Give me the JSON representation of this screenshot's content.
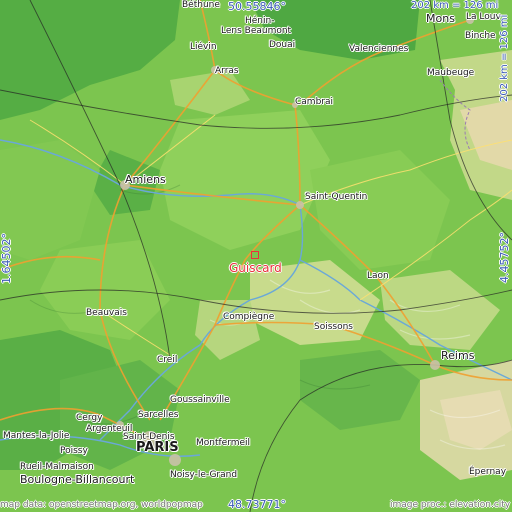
{
  "map": {
    "highlight_place": "Guiscard",
    "colors": {
      "lowland": "#5fb849",
      "midland": "#8ccf55",
      "upland": "#c7db8a",
      "hills": "#ded3a4",
      "water": "#6aa8d8",
      "roads": "#f0a030",
      "borders": "#222222",
      "accent": "#e8323c",
      "coord": "#3d5cb8"
    },
    "coords": {
      "top": "50.55846°",
      "bottom": "48.73771°",
      "left": "1.64502°",
      "right": "4.45752°"
    },
    "scale": {
      "top": "202 km = 126 mi",
      "right": "202 km = 126 mi"
    },
    "credits": {
      "left": "map data: openstreetmap.org, worldpopmap",
      "right": "image proc.: elevation.city"
    },
    "cities": [
      {
        "name": "Béthune"
      },
      {
        "name": "Hénin-"
      },
      {
        "name": "Lens Beaumont"
      },
      {
        "name": "Liévin"
      },
      {
        "name": "Douai"
      },
      {
        "name": "Arras"
      },
      {
        "name": "Mons"
      },
      {
        "name": "La Louv"
      },
      {
        "name": "Binche"
      },
      {
        "name": "Valenciennes"
      },
      {
        "name": "Maubeuge"
      },
      {
        "name": "Cambrai"
      },
      {
        "name": "Amiens"
      },
      {
        "name": "Saint-Quentin"
      },
      {
        "name": "Laon"
      },
      {
        "name": "Beauvais"
      },
      {
        "name": "Compiègne"
      },
      {
        "name": "Soissons"
      },
      {
        "name": "Reims"
      },
      {
        "name": "Creil"
      },
      {
        "name": "Goussainville"
      },
      {
        "name": "Cergy"
      },
      {
        "name": "Sarcelles"
      },
      {
        "name": "Mantes-la-Jolie"
      },
      {
        "name": "Argenteuil"
      },
      {
        "name": "Poissy"
      },
      {
        "name": "Saint-Denis"
      },
      {
        "name": "Montfermeil"
      },
      {
        "name": "PARIS"
      },
      {
        "name": "Rueil-Malmaison"
      },
      {
        "name": "Boulogne-Billancourt"
      },
      {
        "name": "Noisy-le-Grand"
      },
      {
        "name": "Épernay"
      }
    ]
  }
}
